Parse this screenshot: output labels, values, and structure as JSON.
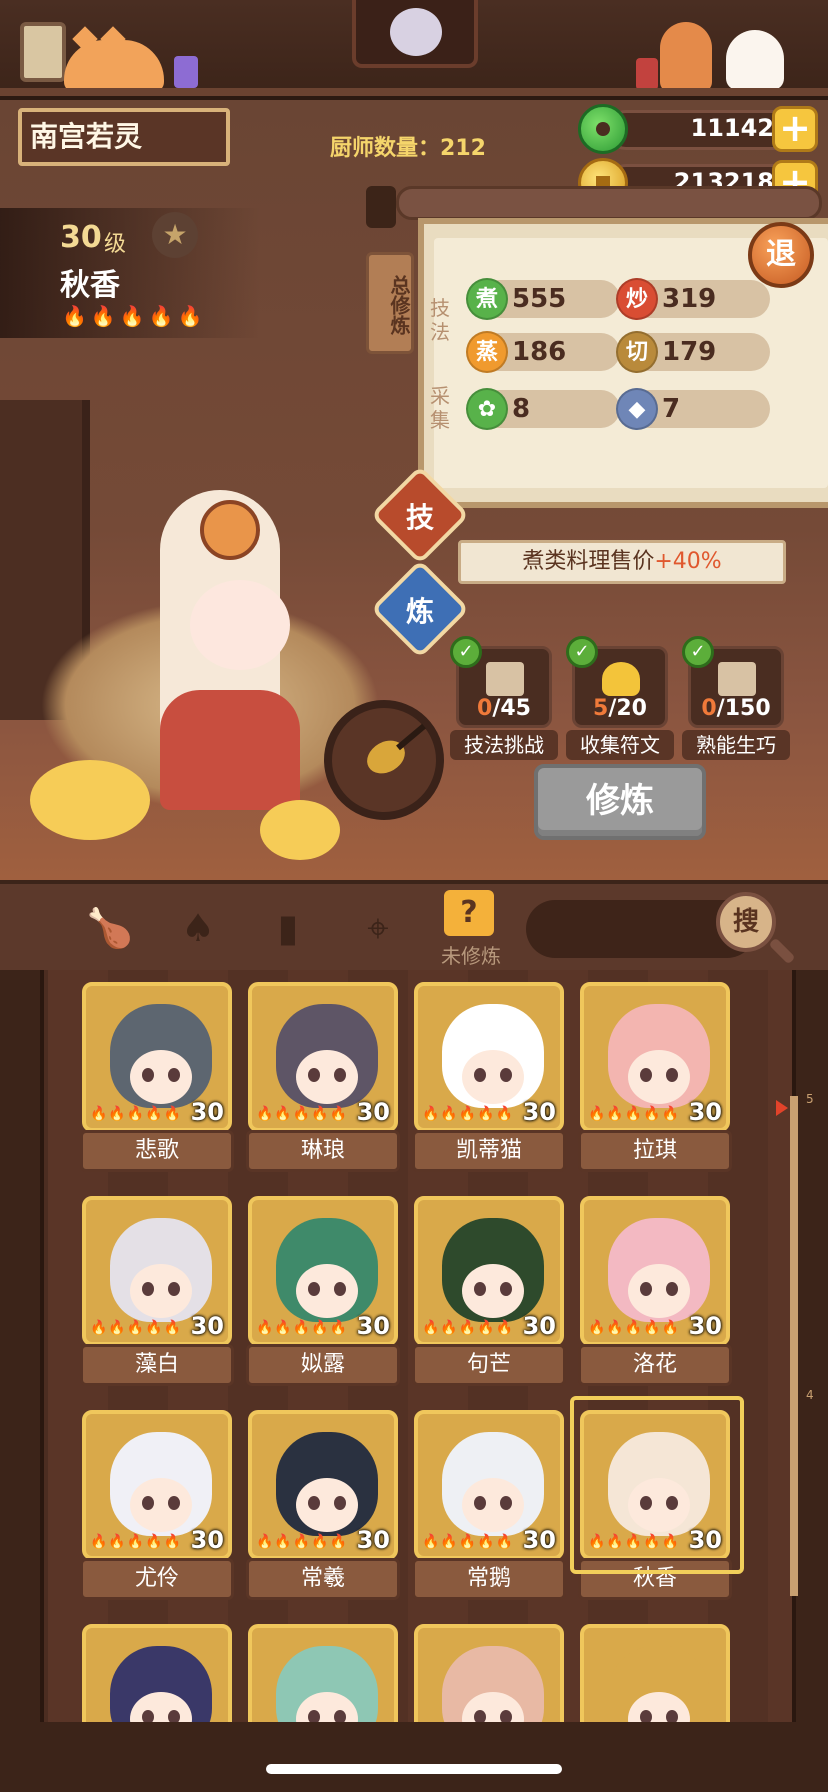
{
  "player": {
    "name": "南宫若灵"
  },
  "chef_count": {
    "label": "厨师数量：",
    "value": "212"
  },
  "currency": {
    "jade": {
      "value": "11142",
      "plus": "+"
    },
    "gold": {
      "value": "213218",
      "plus": "+"
    }
  },
  "selected_chef": {
    "level": "30",
    "level_unit": "级",
    "name": "秋香",
    "star_icon": "★",
    "flames": "🔥🔥🔥🔥🔥"
  },
  "panel": {
    "total_tag": "总修炼",
    "exit": "退",
    "label_skill": "技法",
    "label_gather": "采集",
    "stats": [
      {
        "icon": "煮",
        "value": "555"
      },
      {
        "icon": "炒",
        "value": "319"
      },
      {
        "icon": "蒸",
        "value": "186"
      },
      {
        "icon": "切",
        "value": "179"
      },
      {
        "icon": "",
        "value": "8"
      },
      {
        "icon": "",
        "value": "7"
      }
    ]
  },
  "buttons": {
    "tech": "技",
    "refine": "炼",
    "cultivate": "修炼"
  },
  "bonus": {
    "text": "煮类料理售价",
    "pct": "+40%"
  },
  "challenges": [
    {
      "got": "0",
      "total": "/45",
      "label": "技法挑战"
    },
    {
      "got": "5",
      "total": "/20",
      "label": "收集符文"
    },
    {
      "got": "0",
      "total": "/150",
      "label": "熟能生巧"
    }
  ],
  "toolbar": {
    "unrefined_label": "未修炼",
    "unrefined_icon": "?",
    "search": "搜",
    "search_placeholder": ""
  },
  "chefs": [
    {
      "name": "悲歌",
      "level": "30",
      "hair": "#5d6670"
    },
    {
      "name": "琳琅",
      "level": "30",
      "hair": "#5e5566"
    },
    {
      "name": "凯蒂猫",
      "level": "30",
      "hair": "#ffffff"
    },
    {
      "name": "拉琪",
      "level": "30",
      "hair": "#f3b5b0"
    },
    {
      "name": "藻白",
      "level": "30",
      "hair": "#e4e0e6"
    },
    {
      "name": "姒露",
      "level": "30",
      "hair": "#3f8a6a"
    },
    {
      "name": "句芒",
      "level": "30",
      "hair": "#2e4a2c"
    },
    {
      "name": "洛花",
      "level": "30",
      "hair": "#f3b9c2"
    },
    {
      "name": "尤伶",
      "level": "30",
      "hair": "#f0f0f6"
    },
    {
      "name": "常羲",
      "level": "30",
      "hair": "#2a3140"
    },
    {
      "name": "常鹅",
      "level": "30",
      "hair": "#eef0f4"
    },
    {
      "name": "秋香",
      "level": "30",
      "hair": "#f5e6d6"
    },
    {
      "name": "",
      "level": "",
      "hair": "#3a3868"
    },
    {
      "name": "",
      "level": "",
      "hair": "#8ec7b4"
    },
    {
      "name": "",
      "level": "",
      "hair": "#e8b9a4"
    },
    {
      "name": "",
      "level": "",
      "hair": "#d9a94a"
    }
  ],
  "card_flames": "🔥🔥🔥🔥🔥",
  "scroll": {
    "top_label": "5",
    "mid_label": "4"
  },
  "colors": {
    "accent_gold": "#f0c75c",
    "bonus_pct": "#e0582e",
    "cultivate_disabled": "#9a9a9a"
  }
}
